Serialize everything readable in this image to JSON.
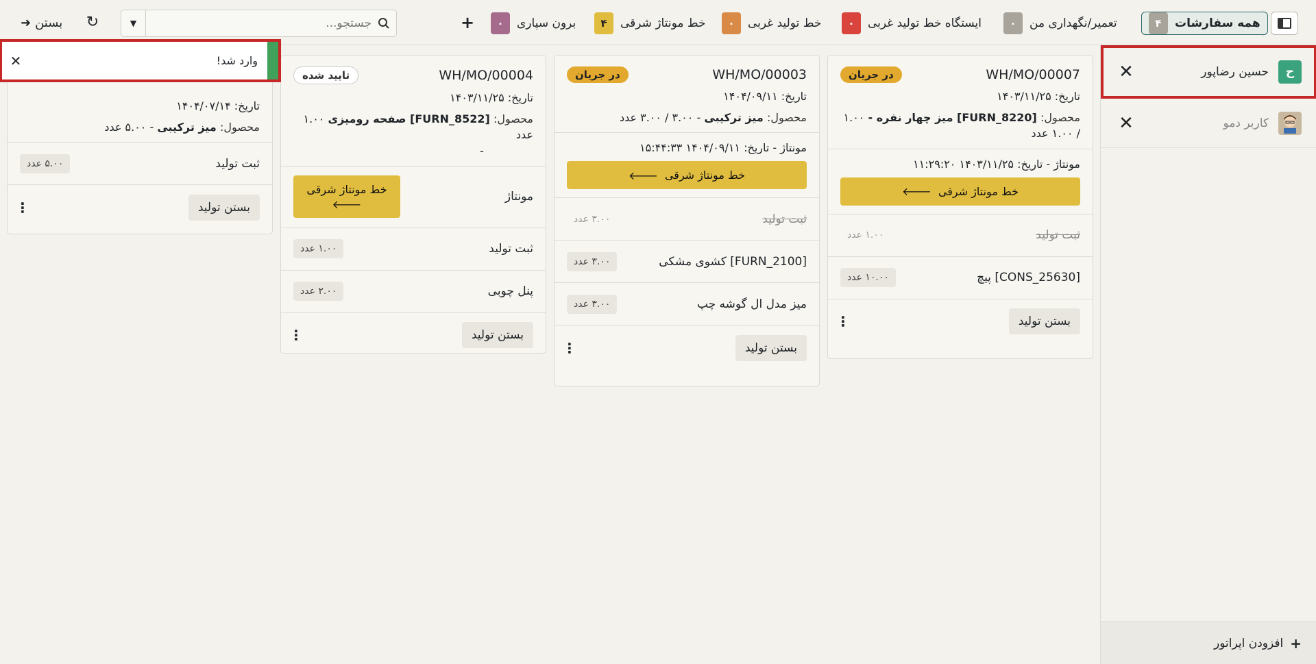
{
  "topbar": {
    "filters": [
      {
        "label": "همه سفارشات",
        "count": "۴",
        "color": "#a8a39b",
        "active": true
      },
      {
        "label": "تعمیر/نگهداری من",
        "count": "۰",
        "color": "#a8a39b"
      },
      {
        "label": "ایستگاه خط تولید غربی",
        "count": "۰",
        "color": "#d9453d"
      },
      {
        "label": "خط تولید غربی",
        "count": "۰",
        "color": "#d98a46"
      },
      {
        "label": "خط مونتاژ شرقی",
        "count": "۴",
        "color": "#e1bd3f"
      },
      {
        "label": "برون سپاری",
        "count": "۰",
        "color": "#a66a8c"
      }
    ],
    "search_placeholder": "جستجو...",
    "close_label": "بستن"
  },
  "sidebar": {
    "operators": [
      {
        "name": "حسین رضاپور",
        "initial": "ح",
        "color": "#3aa37e",
        "selected": true
      },
      {
        "name": "کاربر دمو",
        "initial": "",
        "color": "#c9b8a0",
        "selected": false
      }
    ],
    "add_operator": "افزودن اپراتور"
  },
  "toast": {
    "message": "وارد شد!"
  },
  "cards": [
    {
      "ref": "WH/MO/00007",
      "state": "در جریان",
      "date": "تاریخ: ۱۴۰۳/۱۱/۲۵",
      "product_prefix": "محصول:",
      "product": "[FURN_8220] میز چهار نفره -",
      "product_qty": "۱.۰۰ / ۱.۰۰ عدد",
      "workorder": "مونتاژ  - تاریخ: ۱۴۰۳/۱۱/۲۵ ۱۱:۲۹:۲۰",
      "workcenter": "خط مونتاژ شرقی",
      "rows": [
        {
          "name": "ثبت تولید",
          "qty": "۱.۰۰ عدد",
          "done": true
        },
        {
          "name": "[CONS_25630] پیچ",
          "qty": "۱۰.۰۰ عدد",
          "done": false
        }
      ],
      "close": "بستن تولید"
    },
    {
      "ref": "WH/MO/00003",
      "state": "در جریان",
      "date": "تاریخ: ۱۴۰۴/۰۹/۱۱",
      "product_prefix": "محصول:",
      "product": "میز ترکیبی",
      "product_qty": "- ۳.۰۰ / ۳.۰۰ عدد",
      "workorder": "مونتاژ  - تاریخ: ۱۴۰۴/۰۹/۱۱ ۱۵:۴۴:۳۳",
      "workcenter": "خط مونتاژ شرقی",
      "rows": [
        {
          "name": "ثبت تولید",
          "qty": "۳.۰۰ عدد",
          "done": true
        },
        {
          "name": "[FURN_2100] کشوی مشکی",
          "qty": "۳.۰۰ عدد",
          "done": false
        },
        {
          "name": "میز مدل ال گوشه چپ",
          "qty": "۳.۰۰ عدد",
          "done": false
        }
      ],
      "close": "بستن تولید"
    },
    {
      "ref": "WH/MO/00004",
      "state": "تایید شده",
      "date": "تاریخ: ۱۴۰۳/۱۱/۲۵",
      "product_prefix": "محصول:",
      "product": "[FURN_8522] صفحه رومیزی",
      "product_qty": "۱.۰۰ عدد",
      "product_tail": "-",
      "workorder_label": "مونتاژ",
      "workcenter": "خط مونتاژ شرقی",
      "rows": [
        {
          "name": "ثبت تولید",
          "qty": "۱.۰۰ عدد",
          "done": false
        },
        {
          "name": "پنل چوبی",
          "qty": "۲.۰۰ عدد",
          "done": false
        }
      ],
      "close": "بستن تولید"
    },
    {
      "date": "تاریخ: ۱۴۰۴/۰۷/۱۴",
      "product_prefix": "محصول:",
      "product": "میز ترکیبی",
      "product_qty": "- ۵.۰۰ عدد",
      "rows": [
        {
          "name": "ثبت تولید",
          "qty": "۵.۰۰ عدد",
          "done": false
        }
      ],
      "close": "بستن تولید"
    }
  ]
}
